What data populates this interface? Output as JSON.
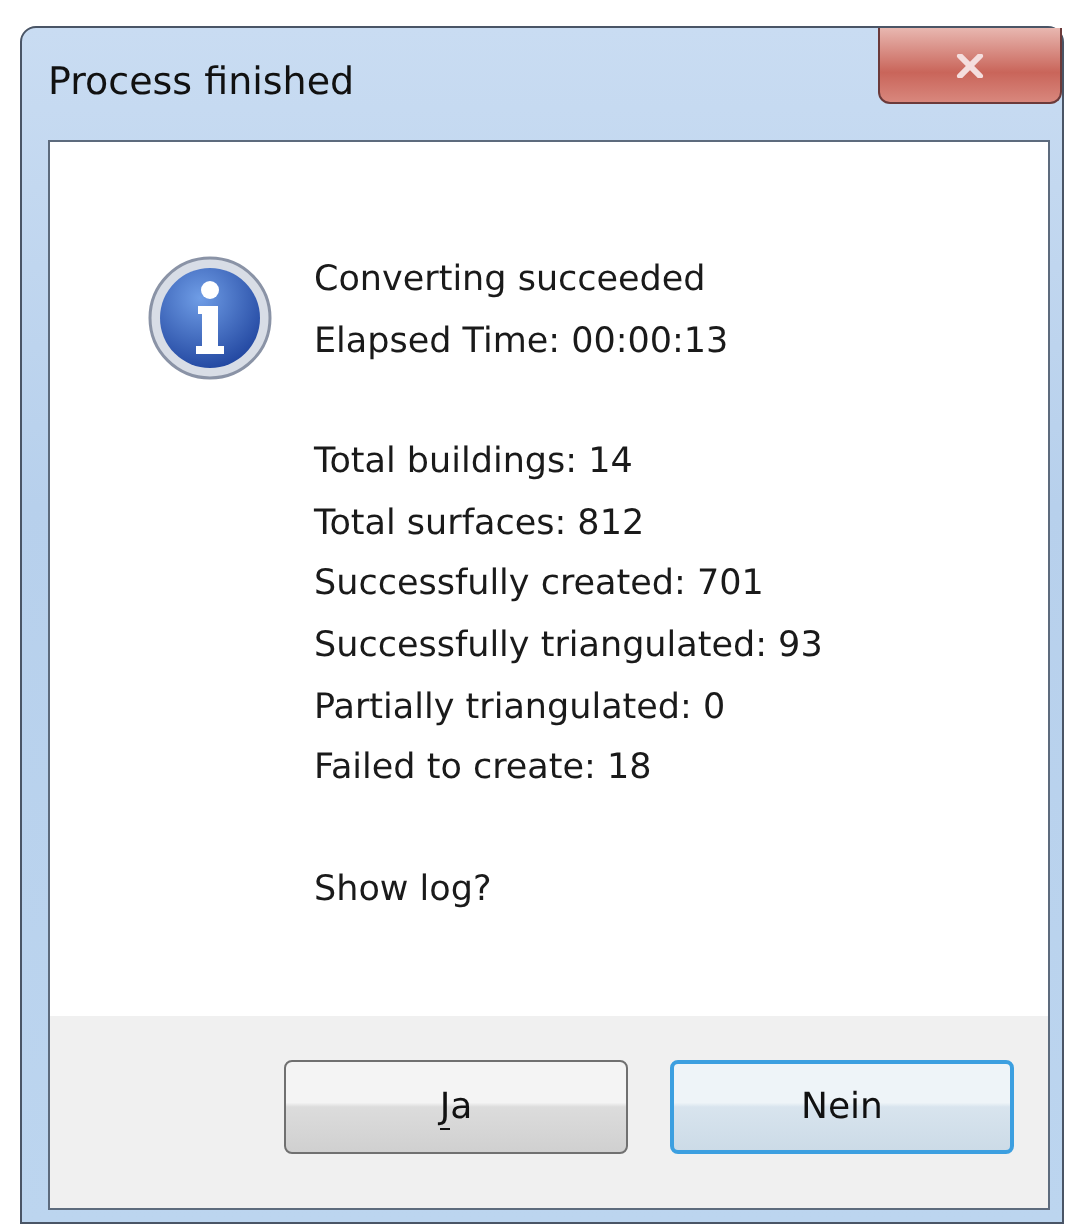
{
  "window": {
    "title": "Process finished"
  },
  "message": {
    "paragraphs": [
      [
        "Converting succeeded",
        "Elapsed Time: 00:00:13"
      ],
      [
        "Total buildings: 14",
        "Total surfaces: 812",
        "Successfully created: 701",
        "Successfully triangulated: 93",
        "Partially triangulated: 0",
        "Failed to create: 18"
      ],
      [
        "Show log?"
      ]
    ]
  },
  "buttons": [
    {
      "label": "Ja",
      "mnemonic": true,
      "default": false
    },
    {
      "label": "Nein",
      "mnemonic": false,
      "default": true
    }
  ]
}
